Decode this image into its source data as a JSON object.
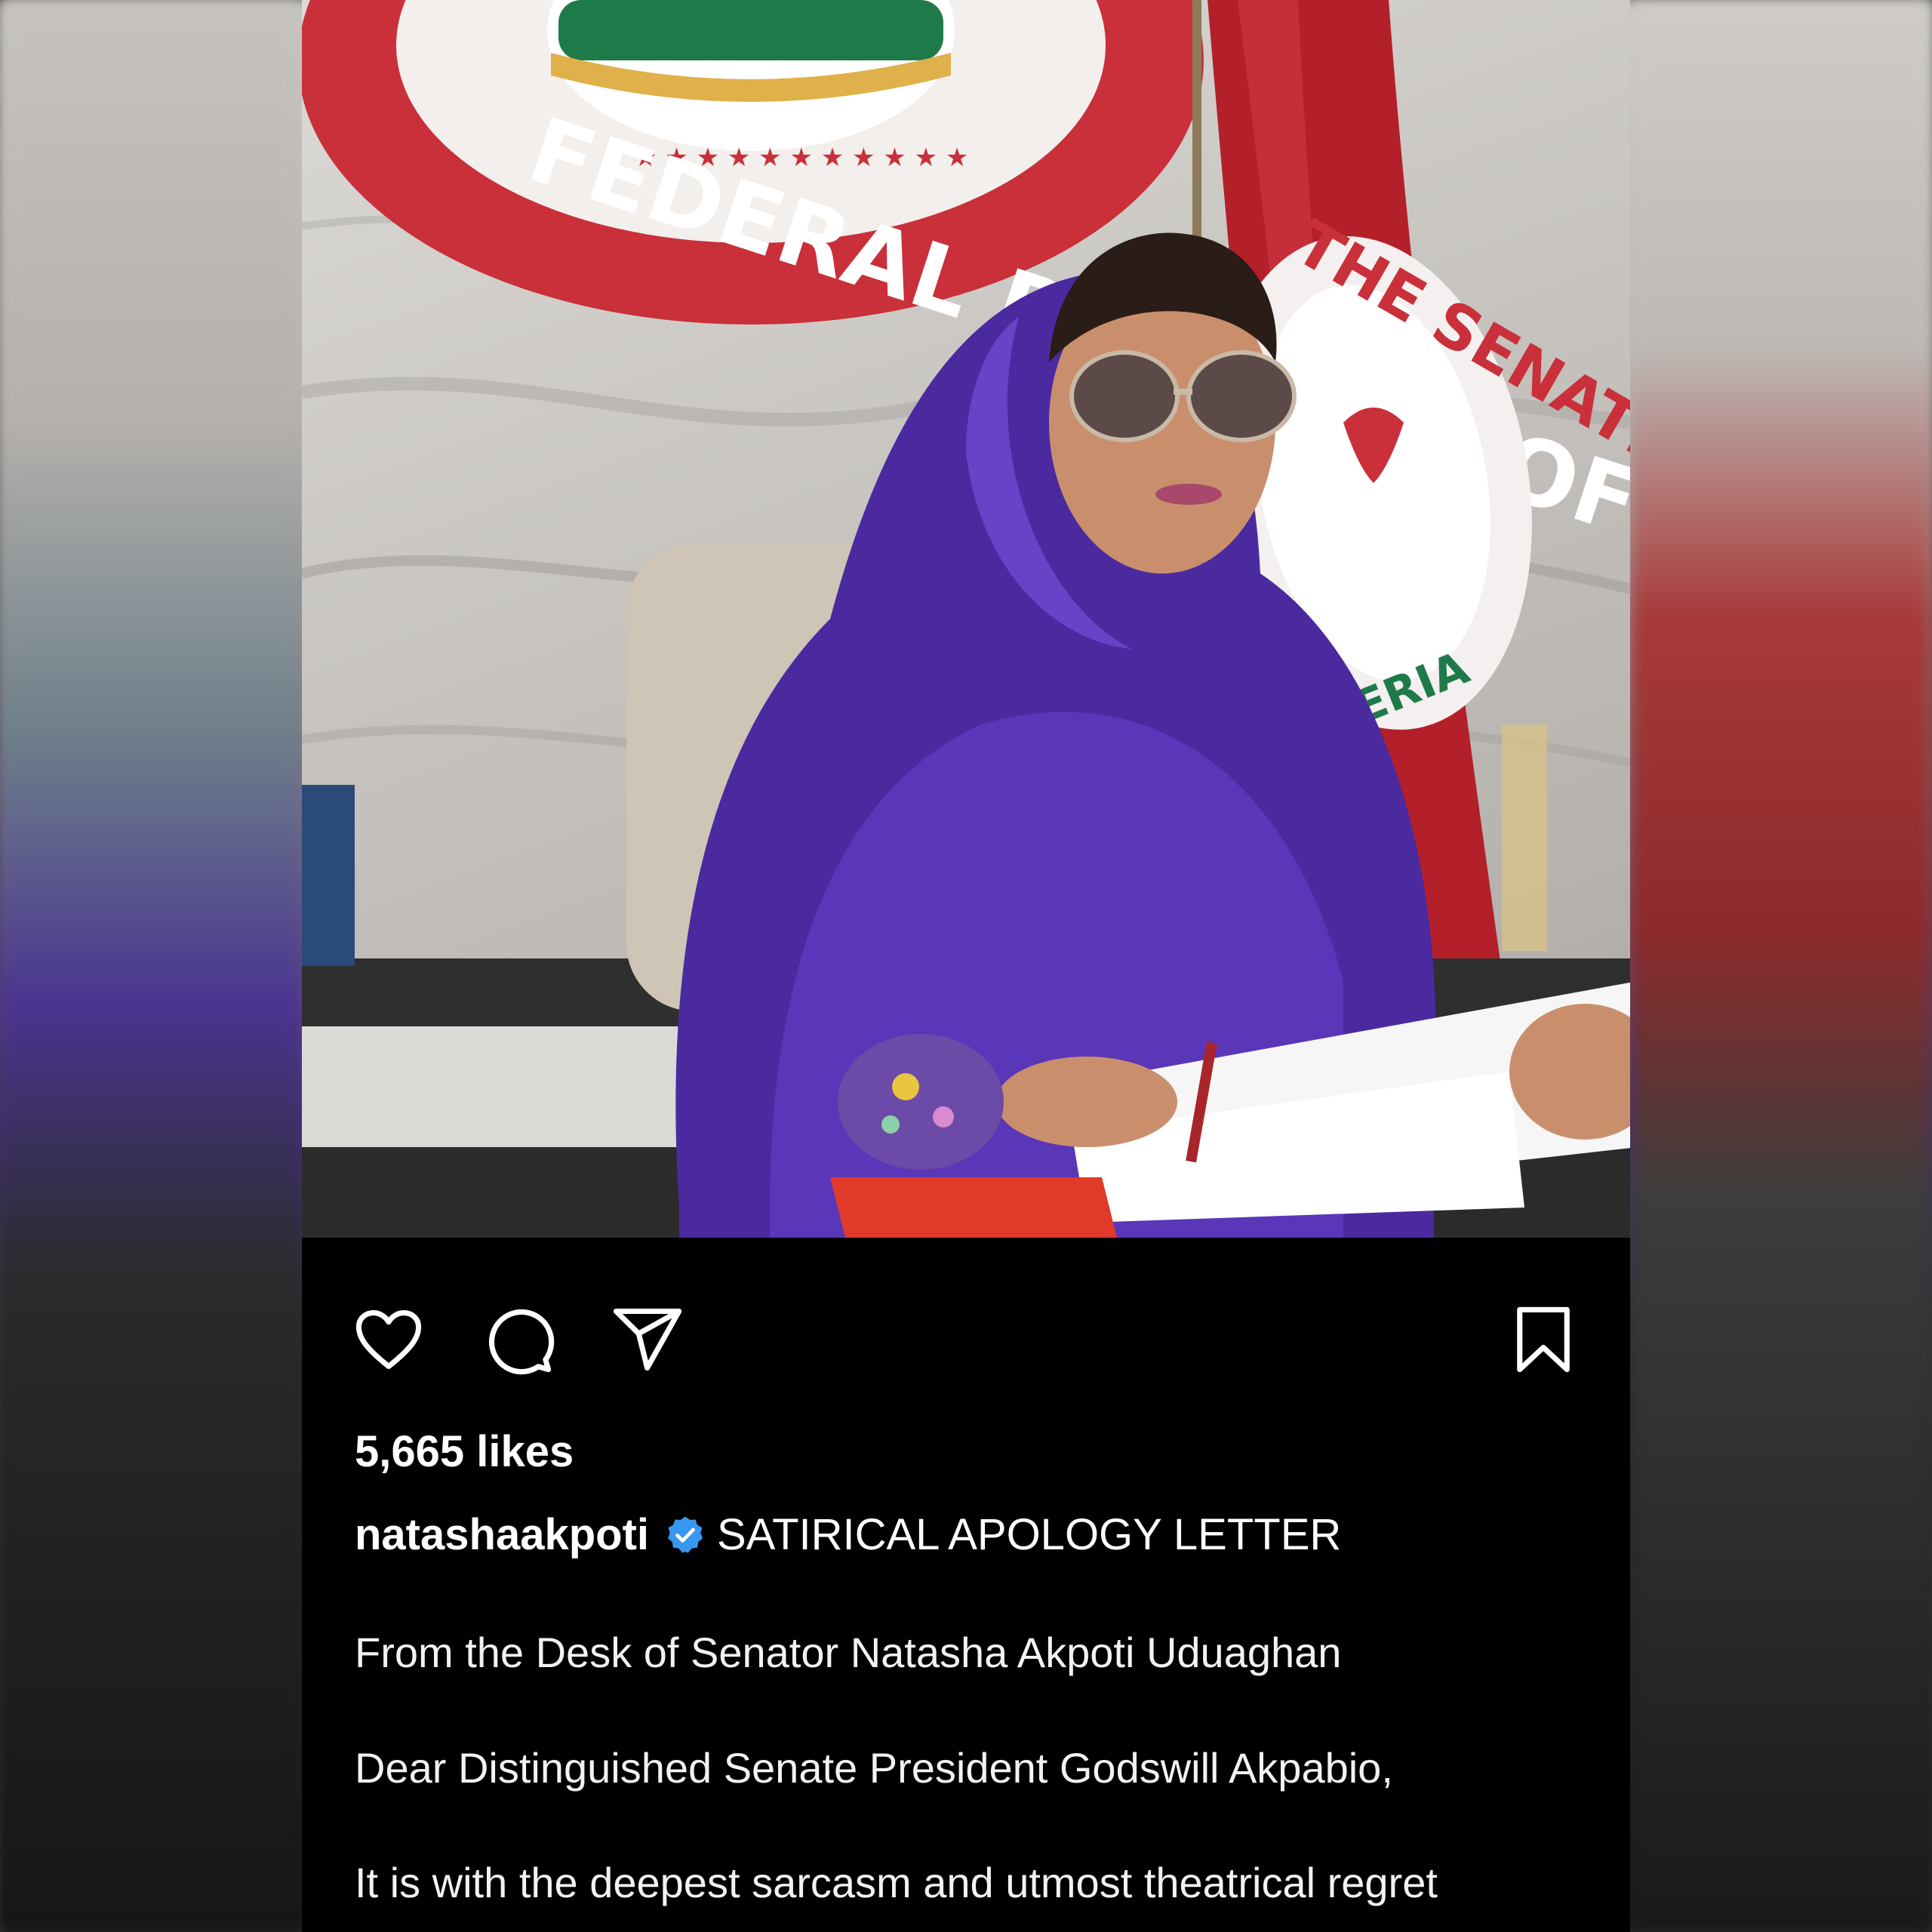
{
  "post": {
    "likes": "5,665 likes",
    "username": "natashaakpoti",
    "caption_title": "SATIRICAL APOLOGY LETTER",
    "paragraphs": [
      "From the Desk of Senator Natasha Akpoti Uduaghan",
      "Dear Distinguished Senate President Godswill Akpabio,",
      "It is with the deepest sarcasm and utmost theatrical regret"
    ]
  },
  "photo": {
    "seal_text": "FEDERAL REPUBLIC OF NIGERIA",
    "flag_text": "THE SENATE",
    "flag_bottom_text": "NIGERIA"
  },
  "icons": {
    "like": "heart-icon",
    "comment": "comment-icon",
    "share": "send-icon",
    "save": "bookmark-icon",
    "verified": "verified-badge-icon"
  },
  "colors": {
    "background": "#000000",
    "text": "#ffffff",
    "verified": "#3897f0",
    "robe": "#4b2aa0",
    "flag": "#b3202a"
  }
}
